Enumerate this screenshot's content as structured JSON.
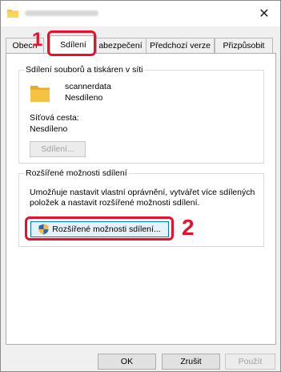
{
  "window": {
    "close_glyph": "✕"
  },
  "tabs": [
    {
      "label": "Obecn"
    },
    {
      "label": "Sdílení",
      "active": true
    },
    {
      "label": "abezpečení"
    },
    {
      "label": "Předchozí verze"
    },
    {
      "label": "Přizpůsobit"
    }
  ],
  "sharing_group": {
    "title": "Sdílení souborů a tiskáren v síti",
    "folder_name": "scannerdata",
    "folder_status": "Nesdíleno",
    "network_path_label": "Síťová cesta:",
    "network_path_value": "Nesdíleno",
    "share_button": "Sdílení..."
  },
  "advanced_group": {
    "title": "Rozšířené možnosti sdílení",
    "description_line1": "Umožňuje nastavit vlastní oprávnění, vytvářet více sdílených",
    "description_line2": "položek a nastavit rozšířené možnosti sdílení.",
    "button": "Rozšířené možnosti sdílení..."
  },
  "dialog_buttons": {
    "ok": "OK",
    "cancel": "Zrušit",
    "apply": "Použít"
  },
  "callouts": {
    "step1": "1",
    "step2": "2"
  },
  "colors": {
    "highlight": "#e8112d",
    "accent": "#0078d7",
    "folder": "#f5c242"
  },
  "icons": {
    "folder": "folder-icon",
    "shield": "uac-shield-icon",
    "close": "close-icon"
  }
}
